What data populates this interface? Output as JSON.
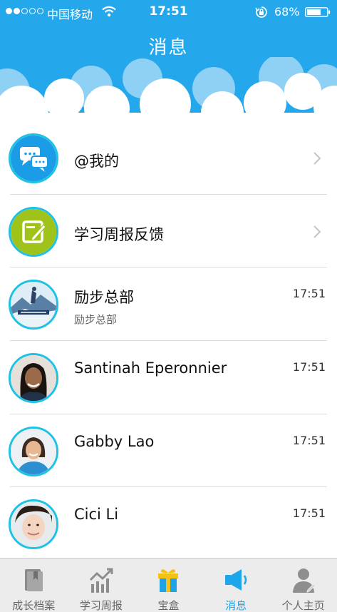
{
  "status_bar": {
    "carrier": "中国移动",
    "time": "17:51",
    "battery": "68%"
  },
  "header": {
    "title": "消息"
  },
  "messages": [
    {
      "title": "@我的",
      "subtitle": "",
      "time": "",
      "icon": "chat-bubbles-icon",
      "has_chevron": true
    },
    {
      "title": "学习周报反馈",
      "subtitle": "",
      "time": "",
      "icon": "edit-note-icon",
      "has_chevron": true
    },
    {
      "title": "励步总部",
      "subtitle": "励步总部",
      "time": "17:51",
      "icon": "snow-scene-avatar"
    },
    {
      "title": "Santinah Eperonnier",
      "subtitle": "",
      "time": "17:51",
      "icon": "person-avatar"
    },
    {
      "title": "Gabby Lao",
      "subtitle": "",
      "time": "17:51",
      "icon": "person-avatar"
    },
    {
      "title": "Cici Li",
      "subtitle": "",
      "time": "17:51",
      "icon": "person-avatar"
    }
  ],
  "tabs": [
    {
      "label": "成长档案",
      "icon": "book-icon",
      "active": false
    },
    {
      "label": "学习周报",
      "icon": "trend-chart-icon",
      "active": false
    },
    {
      "label": "宝盒",
      "icon": "gift-box-icon",
      "active": false
    },
    {
      "label": "消息",
      "icon": "speaker-icon",
      "active": true
    },
    {
      "label": "个人主页",
      "icon": "user-profile-icon",
      "active": false
    }
  ],
  "colors": {
    "header_blue": "#25a7ec",
    "avatar_ring": "#1ec2e4",
    "active_tab": "#1ea6ea",
    "chat_icon_bg": "#1b9ce6",
    "note_icon_bg": "#9fc31b",
    "gift_yellow": "#f2c21a"
  }
}
